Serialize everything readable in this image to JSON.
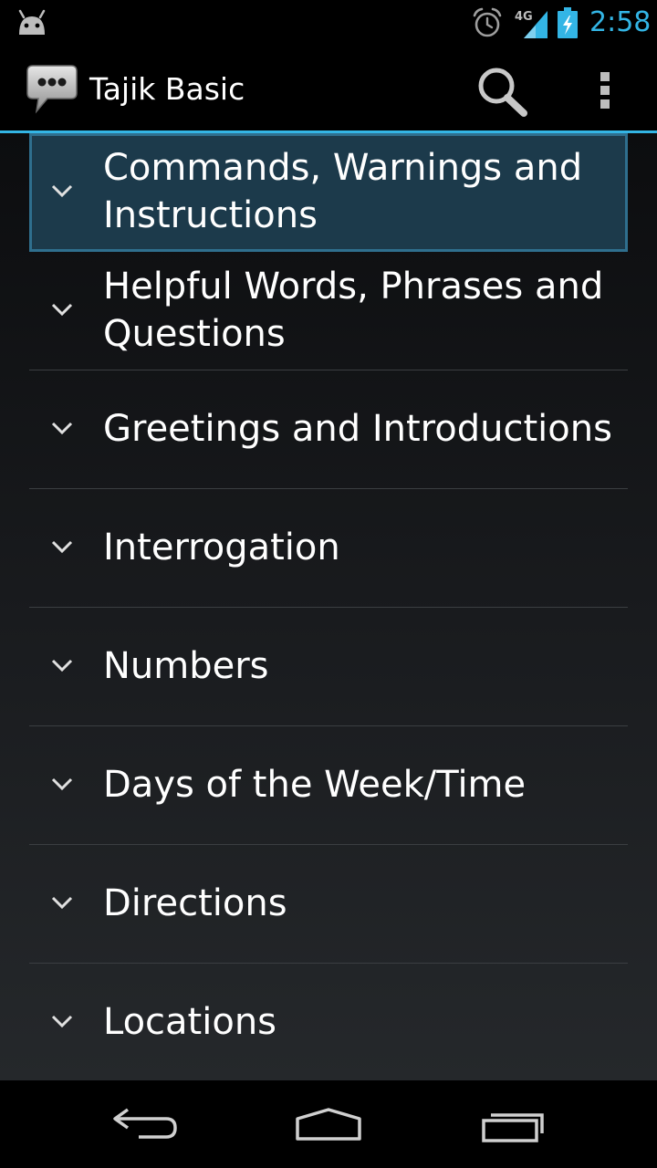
{
  "status_bar": {
    "time": "2:58",
    "network_label": "4G",
    "icons": [
      "android-icon",
      "alarm-icon",
      "signal-icon",
      "battery-charging-icon"
    ],
    "accent_color": "#33b5e5"
  },
  "action_bar": {
    "title": "Tajik Basic",
    "icons": [
      "chat-bubble-icon",
      "search-icon",
      "overflow-menu-icon"
    ]
  },
  "categories": [
    {
      "label": "Commands, Warnings and Instructions",
      "selected": true
    },
    {
      "label": "Helpful Words, Phrases and Questions",
      "selected": false
    },
    {
      "label": "Greetings and Introductions",
      "selected": false
    },
    {
      "label": "Interrogation",
      "selected": false
    },
    {
      "label": "Numbers",
      "selected": false
    },
    {
      "label": "Days of the Week/Time",
      "selected": false
    },
    {
      "label": "Directions",
      "selected": false
    },
    {
      "label": "Locations",
      "selected": false
    }
  ],
  "nav_bar": {
    "icons": [
      "back-icon",
      "home-icon",
      "recent-apps-icon"
    ]
  }
}
